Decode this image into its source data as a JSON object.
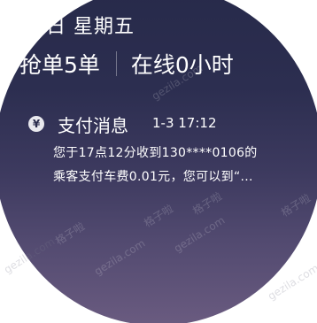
{
  "status": {
    "date_text": "日 星期五"
  },
  "stats": {
    "orders_text": "抢单5单",
    "online_text": "在线0小时"
  },
  "notification": {
    "icon": "yen-icon",
    "icon_glyph": "¥",
    "title": "支付消息",
    "time": "1-3 17:12",
    "body_line1": "您于17点12分收到130****0106的",
    "body_line2": "乘客支付车费0.01元，您可以到“..."
  },
  "watermarks": {
    "site": "gezila.com",
    "cn": "格子啦"
  },
  "colors": {
    "bg_top": "#272a4a",
    "bg_bottom": "#6a5b80",
    "text": "#ffffff"
  }
}
